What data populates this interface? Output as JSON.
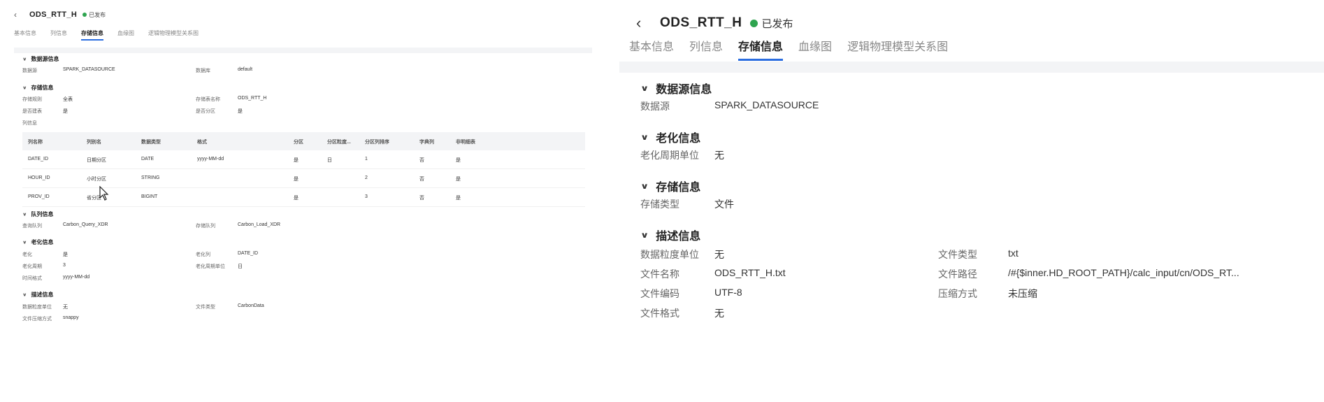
{
  "left": {
    "header": {
      "title": "ODS_RTT_H",
      "status": "已发布"
    },
    "tabs": [
      "基本信息",
      "列信息",
      "存储信息",
      "血缘图",
      "逻辑物理模型关系图"
    ],
    "datasource": {
      "title": "数据源信息",
      "label1": "数据源",
      "value1": "SPARK_DATASOURCE",
      "label2": "数据库",
      "value2": "default"
    },
    "storage": {
      "title": "存储信息",
      "rows": [
        {
          "l1": "存储规则",
          "v1": "全表",
          "l2": "存储表名称",
          "v2": "ODS_RTT_H"
        },
        {
          "l1": "是否建表",
          "v1": "是",
          "l2": "是否分区",
          "v2": "是"
        }
      ],
      "list_label": "列信息"
    },
    "table": {
      "headers": [
        "列名称",
        "列别名",
        "数据类型",
        "格式",
        "分区",
        "分区粒度...",
        "分区列排序",
        "字典列",
        "非明细表"
      ],
      "rows": [
        [
          "DATE_ID",
          "日期分区",
          "DATE",
          "yyyy-MM-dd",
          "是",
          "日",
          "1",
          "否",
          "是"
        ],
        [
          "HOUR_ID",
          "小时分区",
          "STRING",
          "",
          "是",
          "",
          "2",
          "否",
          "是"
        ],
        [
          "PROV_ID",
          "省分区",
          "BIGINT",
          "",
          "是",
          "",
          "3",
          "否",
          "是"
        ]
      ]
    },
    "queue": {
      "title": "队列信息",
      "l1": "查询队列",
      "v1": "Carbon_Query_XDR",
      "l2": "存储队列",
      "v2": "Carbon_Load_XDR"
    },
    "aging": {
      "title": "老化信息",
      "rows": [
        {
          "l1": "老化",
          "v1": "是",
          "l2": "老化列",
          "v2": "DATE_ID"
        },
        {
          "l1": "老化周期",
          "v1": "3",
          "l2": "老化周期单位",
          "v2": "日"
        },
        {
          "l1": "时间格式",
          "v1": "yyyy-MM-dd",
          "l2": "",
          "v2": ""
        }
      ]
    },
    "desc": {
      "title": "描述信息",
      "rows": [
        {
          "l1": "数据粒度单位",
          "v1": "无",
          "l2": "文件类型",
          "v2": "CarbonData"
        },
        {
          "l1": "文件压缩方式",
          "v1": "snappy",
          "l2": "",
          "v2": ""
        }
      ]
    }
  },
  "right": {
    "header": {
      "title": "ODS_RTT_H",
      "status": "已发布"
    },
    "tabs": [
      "基本信息",
      "列信息",
      "存储信息",
      "血缘图",
      "逻辑物理模型关系图"
    ],
    "datasource": {
      "title": "数据源信息",
      "label": "数据源",
      "value": "SPARK_DATASOURCE"
    },
    "aging": {
      "title": "老化信息",
      "label": "老化周期单位",
      "value": "无"
    },
    "storage": {
      "title": "存储信息",
      "label": "存储类型",
      "value": "文件"
    },
    "desc": {
      "title": "描述信息",
      "rows": [
        {
          "l1": "数据粒度单位",
          "v1": "无",
          "l2": "文件类型",
          "v2": "txt"
        },
        {
          "l1": "文件名称",
          "v1": "ODS_RTT_H.txt",
          "l2": "文件路径",
          "v2": "/#{$inner.HD_ROOT_PATH}/calc_input/cn/ODS_RT..."
        },
        {
          "l1": "文件编码",
          "v1": "UTF-8",
          "l2": "压缩方式",
          "v2": "未压缩"
        },
        {
          "l1": "文件格式",
          "v1": "无",
          "l2": "",
          "v2": ""
        }
      ]
    }
  },
  "colors": {
    "accent": "#2a6de0",
    "published": "#2ea44f",
    "band": "#f3f4f6"
  }
}
